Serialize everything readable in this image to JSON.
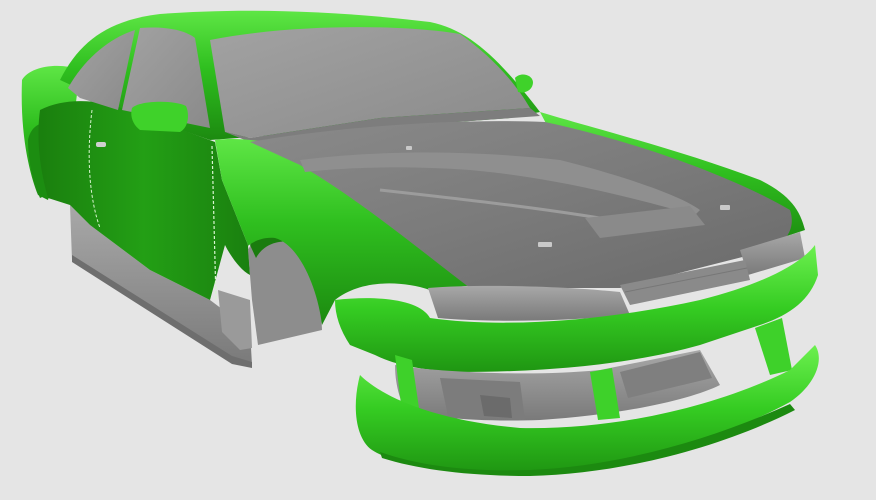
{
  "scene": {
    "background_color": "#e5e5e5",
    "colors": {
      "body_green": "#2fbf1f",
      "body_green_dark": "#1f8f12",
      "body_green_light": "#58e23f",
      "panel_grey": "#8c8c8c",
      "panel_grey_dark": "#6d6d6d",
      "panel_grey_light": "#b3b3b3",
      "glass_grey": "#9a9a9a"
    }
  }
}
